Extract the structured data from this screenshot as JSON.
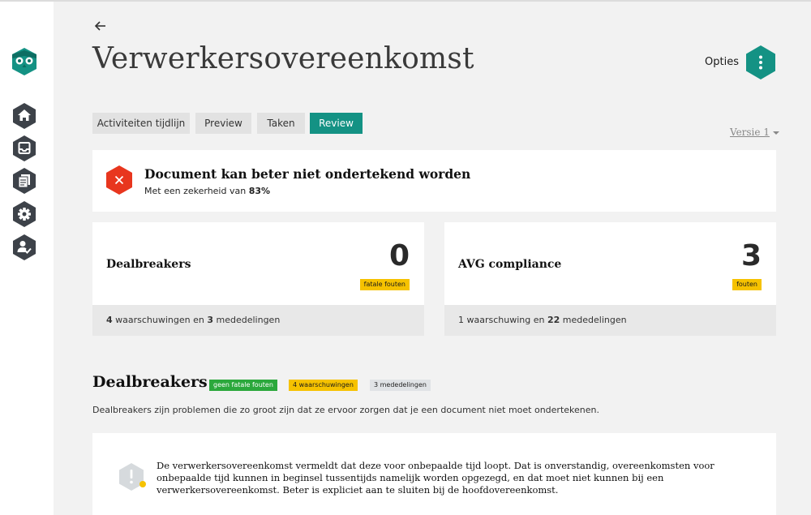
{
  "colors": {
    "accent": "#149284",
    "sidebar_icon": "#3d4249",
    "danger": "#e8361e",
    "warning": "#f6c200",
    "success": "#2ba83c"
  },
  "sidebar": {
    "logo_icon": "owl-logo-icon",
    "items": [
      {
        "icon": "home-icon"
      },
      {
        "icon": "inbox-icon"
      },
      {
        "icon": "documents-icon"
      },
      {
        "icon": "gear-icon"
      },
      {
        "icon": "user-check-icon"
      }
    ]
  },
  "header": {
    "back_icon": "arrow-left-icon",
    "title": "Verwerkersovereenkomst",
    "options_label": "Opties",
    "options_icon": "vertical-dots-icon"
  },
  "tabs": [
    {
      "label": "Activiteiten tijdlijn",
      "active": false
    },
    {
      "label": "Preview",
      "active": false
    },
    {
      "label": "Taken",
      "active": false
    },
    {
      "label": "Review",
      "active": true
    }
  ],
  "version": {
    "label": "Versie 1"
  },
  "alert": {
    "icon": "close-x-icon",
    "title": "Document kan beter niet ondertekend worden",
    "subtitle_prefix": "Met een zekerheid van ",
    "certainty": "83%"
  },
  "cards": [
    {
      "title": "Dealbreakers",
      "count": "0",
      "badge": "fatale fouten",
      "footer_num1": "4",
      "footer_text1": " waarschuwingen en ",
      "footer_num2": "3",
      "footer_text2": " mededelingen"
    },
    {
      "title": "AVG compliance",
      "count": "3",
      "badge": "fouten",
      "footer_num1": "",
      "footer_text1": "1 waarschuwing en ",
      "footer_num2": "22",
      "footer_text2": " mededelingen"
    }
  ],
  "section": {
    "title": "Dealbreakers",
    "badges": {
      "fatal": "geen fatale fouten",
      "warnings": "4 waarschuwingen",
      "notices": "3 mededelingen"
    },
    "description": "Dealbreakers zijn problemen die zo groot zijn dat ze ervoor zorgen dat je een document niet moet ondertekenen."
  },
  "issues": [
    {
      "icon": "warning-exclamation-icon",
      "text": "De verwerkersovereenkomst vermeldt dat deze voor onbepaalde tijd loopt. Dat is onverstandig, overeenkomsten voor onbepaalde tijd kunnen in beginsel tussentijds namelijk worden opgezegd, en dat moet niet kunnen bij een verwerkersovereenkomst. Beter is expliciet aan te sluiten bij de hoofdovereenkomst."
    }
  ]
}
